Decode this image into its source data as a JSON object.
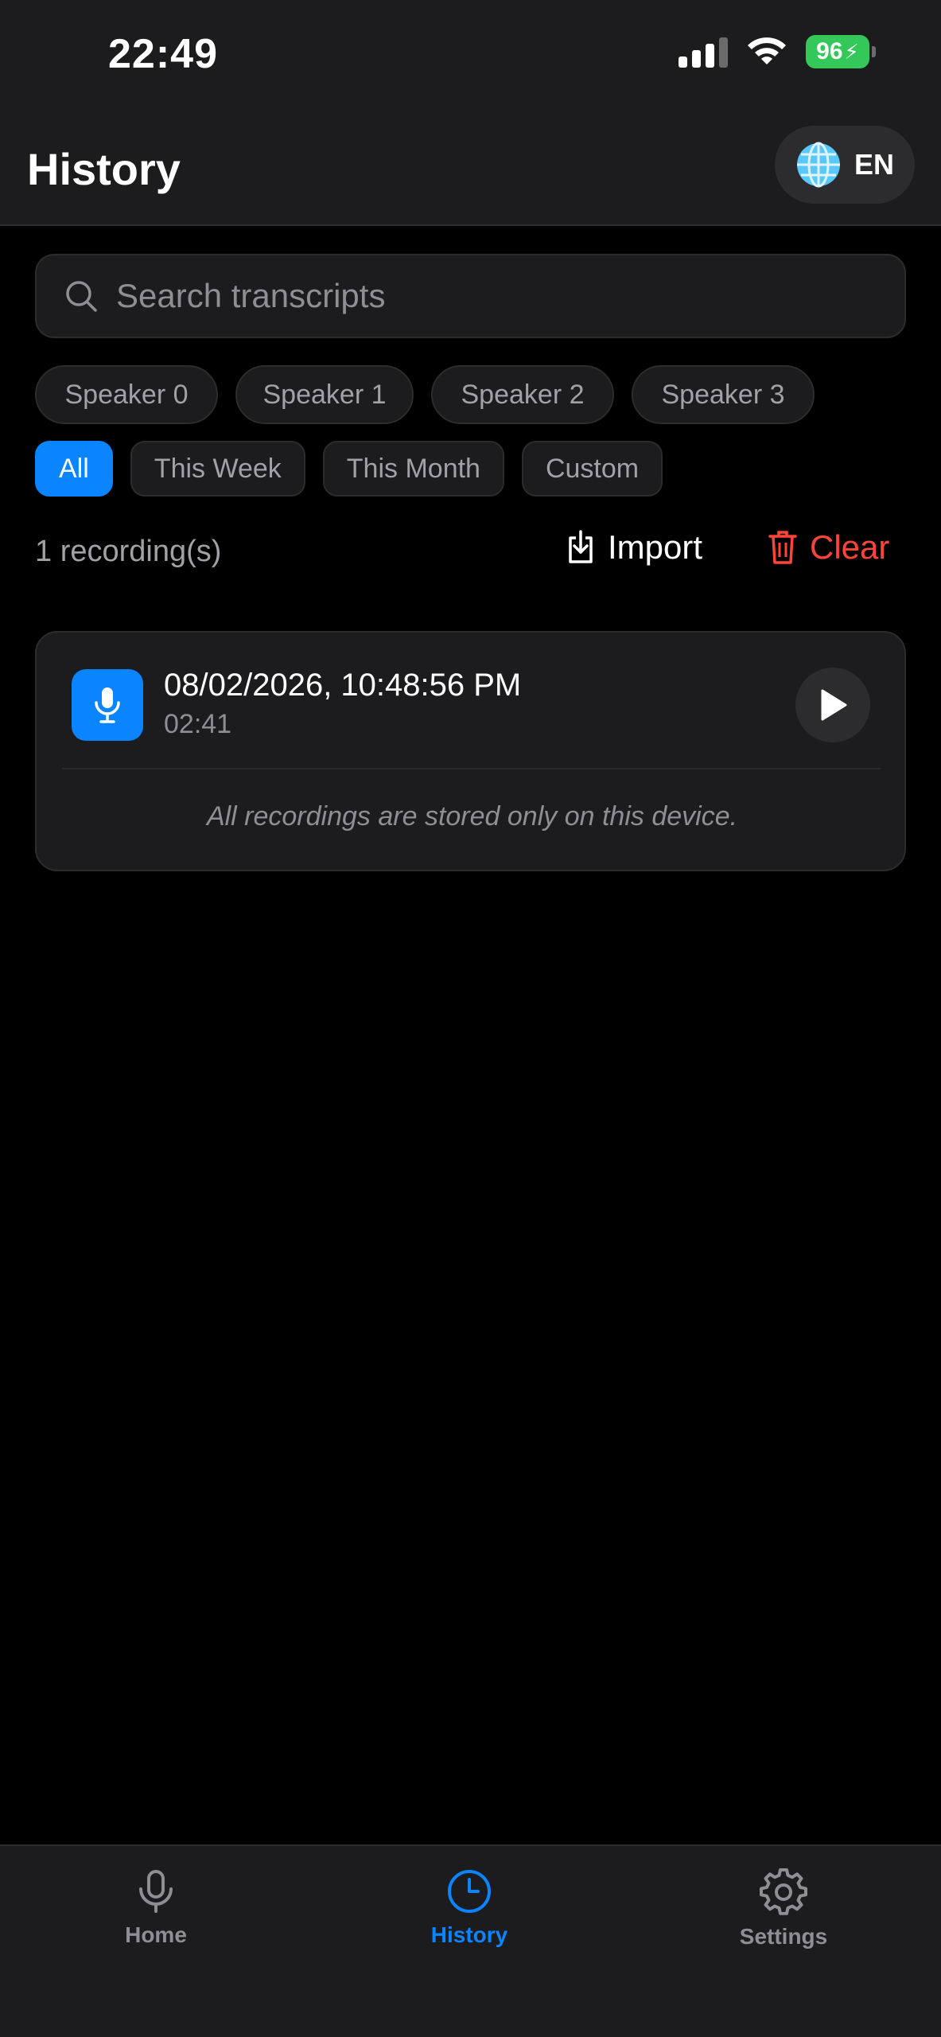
{
  "status_bar": {
    "time": "22:49",
    "battery": "96"
  },
  "header": {
    "title": "History",
    "language": "EN"
  },
  "search": {
    "placeholder": "Search transcripts"
  },
  "speaker_filters": [
    "Speaker 0",
    "Speaker 1",
    "Speaker 2",
    "Speaker 3"
  ],
  "date_filters": [
    {
      "label": "All",
      "active": true
    },
    {
      "label": "This Week",
      "active": false
    },
    {
      "label": "This Month",
      "active": false
    },
    {
      "label": "Custom",
      "active": false
    }
  ],
  "list_header": {
    "count": "1 recording(s)",
    "import_label": "Import",
    "clear_label": "Clear"
  },
  "recordings": [
    {
      "datetime": "08/02/2026, 10:48:56 PM",
      "duration": "02:41"
    }
  ],
  "storage_notice": "All recordings are stored only on this device.",
  "tabs": [
    {
      "label": "Home",
      "icon": "microphone-icon",
      "active": false
    },
    {
      "label": "History",
      "icon": "clock-icon",
      "active": true
    },
    {
      "label": "Settings",
      "icon": "gear-icon",
      "active": false
    }
  ],
  "colors": {
    "accent": "#0a84ff",
    "destructive": "#ff453a",
    "battery": "#34c759"
  }
}
